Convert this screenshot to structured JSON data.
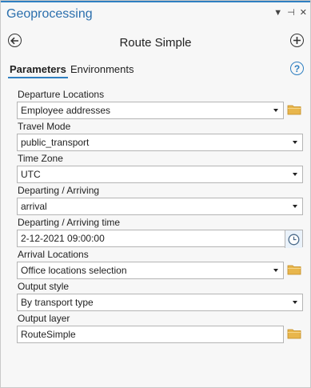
{
  "window": {
    "title": "Geoprocessing",
    "controls": [
      "▼",
      "⊣",
      "✕"
    ]
  },
  "tool": {
    "name": "Route Simple"
  },
  "tabs": [
    {
      "label": "Parameters",
      "active": true
    },
    {
      "label": "Environments",
      "active": false
    }
  ],
  "params": {
    "departure_locations": {
      "label": "Departure Locations",
      "value": "Employee addresses"
    },
    "travel_mode": {
      "label": "Travel Mode",
      "value": "public_transport"
    },
    "time_zone": {
      "label": "Time Zone",
      "value": "UTC"
    },
    "departing_arriving": {
      "label": "Departing / Arriving",
      "value": "arrival"
    },
    "departing_arriving_time": {
      "label": "Departing / Arriving time",
      "value": "2-12-2021 09:00:00"
    },
    "arrival_locations": {
      "label": "Arrival Locations",
      "value": "Office locations selection"
    },
    "output_style": {
      "label": "Output style",
      "value": "By transport type"
    },
    "output_layer": {
      "label": "Output layer",
      "value": "RouteSimple"
    }
  },
  "colors": {
    "accent": "#2f7fc1",
    "folder": "#e8b64c"
  }
}
